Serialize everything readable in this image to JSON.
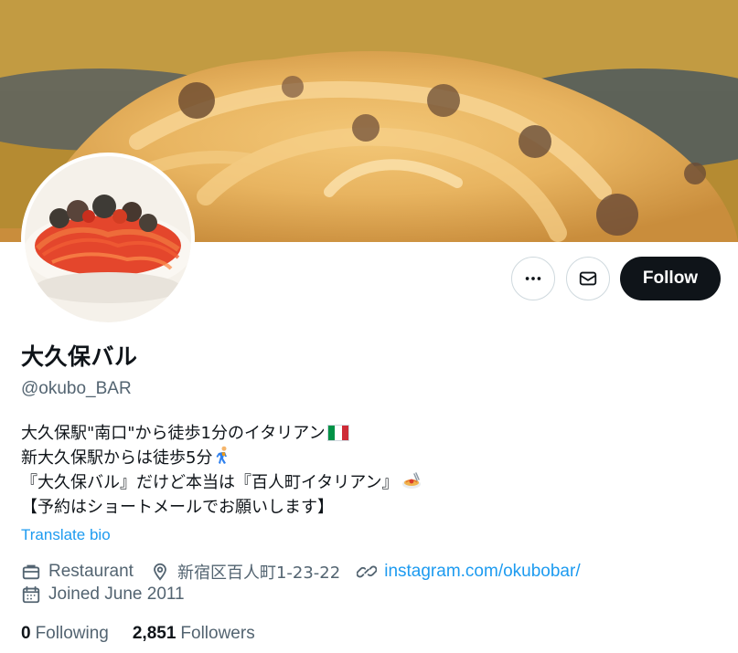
{
  "profile": {
    "name": "大久保バル",
    "handle": "@okubo_BAR"
  },
  "actions": {
    "follow_label": "Follow",
    "more_icon": "more-horizontal-icon",
    "message_icon": "envelope-icon"
  },
  "bio": {
    "lines": [
      "大久保駅\"南口\"から徒歩1分のイタリアン",
      "新大久保駅からは徒歩5分",
      "『大久保バル』だけど本当は『百人町イタリアン』",
      "【予約はショートメールでお願いします】"
    ],
    "emojis": [
      "italy-flag-emoji",
      "person-walking-emoji",
      "spaghetti-emoji"
    ],
    "translate_label": "Translate bio"
  },
  "meta": {
    "category": "Restaurant",
    "location": "新宿区百人町1-23-22",
    "website": "instagram.com/okubobar/",
    "joined": "Joined June 2011",
    "icons": [
      "briefcase-icon",
      "location-pin-icon",
      "link-icon",
      "calendar-icon"
    ]
  },
  "stats": {
    "following_count": "0",
    "following_label": "Following",
    "followers_count": "2,851",
    "followers_label": "Followers"
  },
  "colors": {
    "primary_text": "#0f1419",
    "secondary_text": "#536471",
    "link": "#1d9bf0",
    "follow_button": "#0f1419",
    "border": "#cfd9de"
  }
}
